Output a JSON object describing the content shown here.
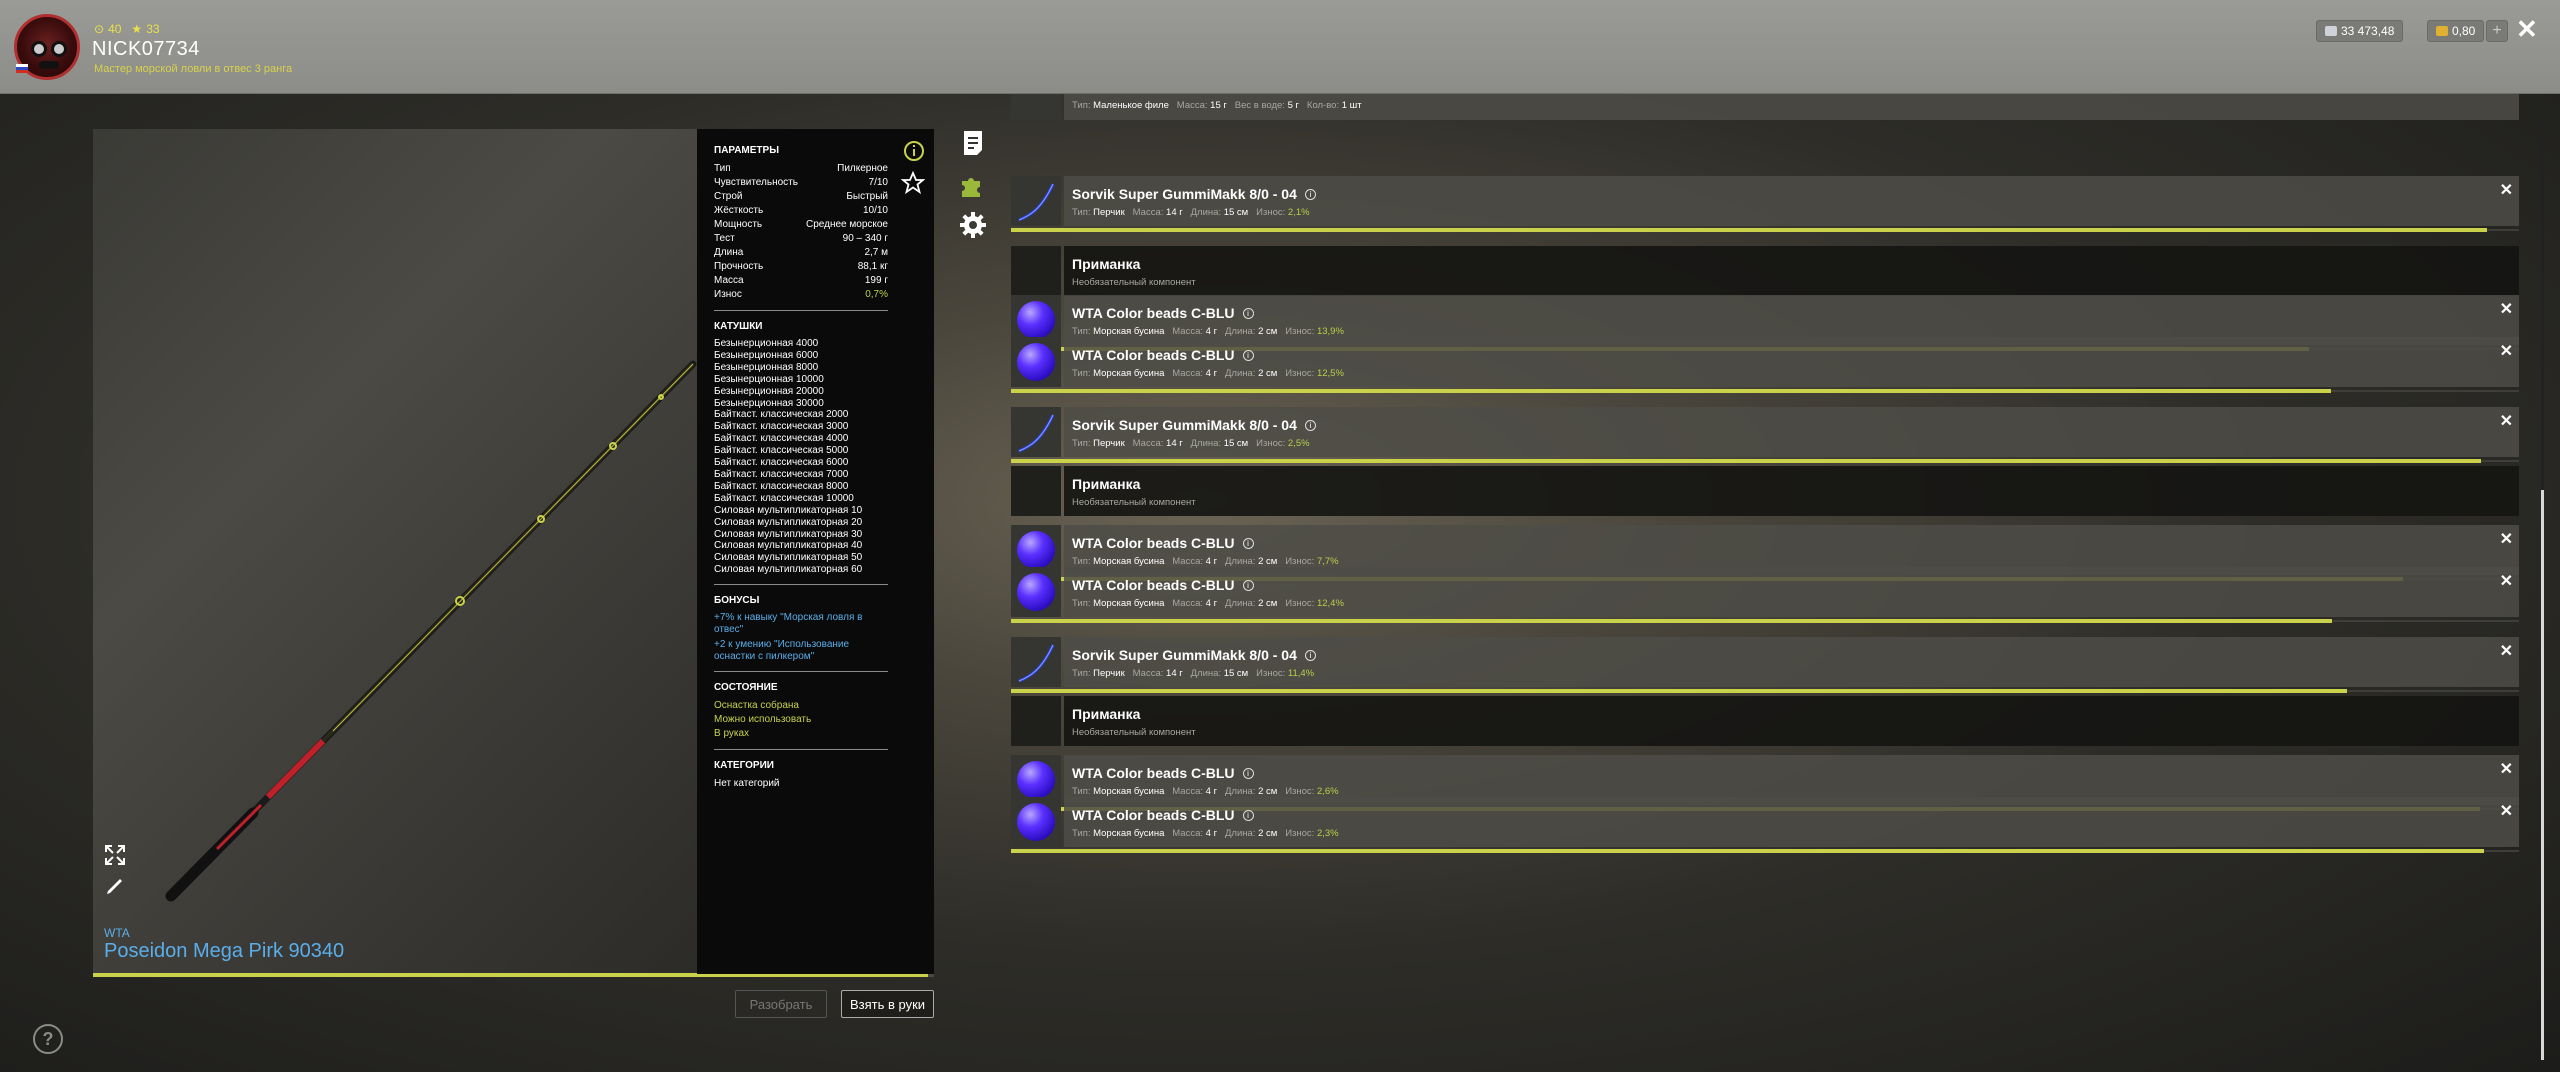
{
  "header": {
    "stat1": "40",
    "stat2": "33",
    "username": "NICK07734",
    "rank": "Мастер морской ловли в отвес 3 ранга",
    "silver": "33 473,48",
    "gold": "0,80",
    "plus": "+",
    "close": "✕"
  },
  "rod": {
    "brand": "WTA",
    "name": "Poseidon Mega Pirk 90340",
    "wear_fraction": 0.993,
    "buttons": {
      "disassemble": "Разобрать",
      "take": "Взять в руки"
    }
  },
  "params": {
    "title": "ПАРАМЕТРЫ",
    "rows": [
      {
        "k": "Тип",
        "v": "Пилкерное"
      },
      {
        "k": "Чувствительность",
        "v": "7/10"
      },
      {
        "k": "Строй",
        "v": "Быстрый"
      },
      {
        "k": "Жёсткость",
        "v": "10/10"
      },
      {
        "k": "Мощность",
        "v": "Среднее морское"
      },
      {
        "k": "Тест",
        "v": "90 – 340 г"
      },
      {
        "k": "Длина",
        "v": "2,7 м"
      },
      {
        "k": "Прочность",
        "v": "88,1 кг"
      },
      {
        "k": "Масса",
        "v": "199 г"
      },
      {
        "k": "Износ",
        "v": "0,7%"
      }
    ]
  },
  "reels": {
    "title": "КАТУШКИ",
    "items": [
      "Безынерционная 4000",
      "Безынерционная 6000",
      "Безынерционная 8000",
      "Безынерционная 10000",
      "Безынерционная 20000",
      "Безынерционная 30000",
      "Байткаст. классическая 2000",
      "Байткаст. классическая 3000",
      "Байткаст. классическая 4000",
      "Байткаст. классическая 5000",
      "Байткаст. классическая 6000",
      "Байткаст. классическая 7000",
      "Байткаст. классическая 8000",
      "Байткаст. классическая 10000",
      "Силовая мультипликаторная 10",
      "Силовая мультипликаторная 20",
      "Силовая мультипликаторная 30",
      "Силовая мультипликаторная 40",
      "Силовая мультипликаторная 50",
      "Силовая мультипликаторная 60"
    ]
  },
  "bonuses": {
    "title": "БОНУСЫ",
    "items": [
      "+7% к навыку \"Морская ловля в отвес\"",
      "+2 к умению \"Использование оснастки с пилкером\""
    ]
  },
  "state": {
    "title": "СОСТОЯНИЕ",
    "items": [
      "Оснастка собрана",
      "Можно использовать",
      "В руках"
    ]
  },
  "categories": {
    "title": "КАТЕГОРИИ",
    "value": "Нет категорий"
  },
  "list": {
    "labels": {
      "type": "Тип:",
      "mass": "Масса:",
      "length": "Длина:",
      "wear": "Износ:",
      "water": "Вес в воде:",
      "count": "Кол-во:"
    },
    "top": {
      "type": "Маленькое филе",
      "mass": "15 г",
      "water": "5 г",
      "count": "1 шт"
    },
    "items": [
      {
        "kind": "lure",
        "title": "Sorvik Super GummiMakk 8/0 - 04",
        "type": "Перчик",
        "mass": "14 г",
        "length": "15 см",
        "wear": "2,1%",
        "wear_fraction": 0.979
      },
      {
        "kind": "empty",
        "title": "Приманка",
        "sub": "Необязательный компонент"
      },
      {
        "kind": "bead",
        "title": "WTA Color beads C-BLU",
        "type": "Морская бусина",
        "mass": "4 г",
        "length": "2 см",
        "wear": "13,9%",
        "wear_fraction": 0.861
      },
      {
        "kind": "bead",
        "title": "WTA Color beads C-BLU",
        "type": "Морская бусина",
        "mass": "4 г",
        "length": "2 см",
        "wear": "12,5%",
        "wear_fraction": 0.875
      },
      {
        "kind": "lure",
        "title": "Sorvik Super GummiMakk 8/0 - 04",
        "type": "Перчик",
        "mass": "14 г",
        "length": "15 см",
        "wear": "2,5%",
        "wear_fraction": 0.975
      },
      {
        "kind": "empty",
        "title": "Приманка",
        "sub": "Необязательный компонент"
      },
      {
        "kind": "bead",
        "title": "WTA Color beads C-BLU",
        "type": "Морская бусина",
        "mass": "4 г",
        "length": "2 см",
        "wear": "7,7%",
        "wear_fraction": 0.923
      },
      {
        "kind": "bead",
        "title": "WTA Color beads C-BLU",
        "type": "Морская бусина",
        "mass": "4 г",
        "length": "2 см",
        "wear": "12,4%",
        "wear_fraction": 0.876
      },
      {
        "kind": "lure",
        "title": "Sorvik Super GummiMakk 8/0 - 04",
        "type": "Перчик",
        "mass": "14 г",
        "length": "15 см",
        "wear": "11,4%",
        "wear_fraction": 0.886
      },
      {
        "kind": "empty",
        "title": "Приманка",
        "sub": "Необязательный компонент"
      },
      {
        "kind": "bead",
        "title": "WTA Color beads C-BLU",
        "type": "Морская бусина",
        "mass": "4 г",
        "length": "2 см",
        "wear": "2,6%",
        "wear_fraction": 0.974
      },
      {
        "kind": "bead",
        "title": "WTA Color beads C-BLU",
        "type": "Морская бусина",
        "mass": "4 г",
        "length": "2 см",
        "wear": "2,3%",
        "wear_fraction": 0.977
      }
    ]
  },
  "colors": {
    "accent": "#c9d24a",
    "link": "#5aaeea",
    "bead": "#4a20f0"
  },
  "icons": [
    "info-icon",
    "star-icon",
    "notes-icon",
    "puzzle-icon",
    "gear-icon",
    "expand-icon",
    "pencil-icon",
    "help-icon",
    "close-icon"
  ]
}
